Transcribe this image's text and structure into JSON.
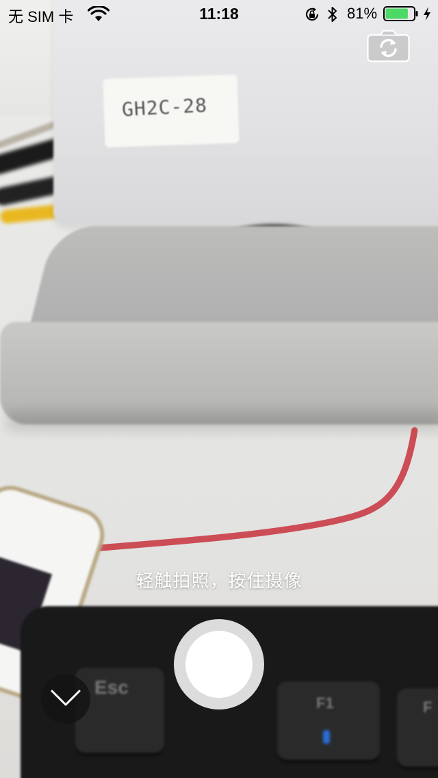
{
  "status_bar": {
    "carrier": "无 SIM 卡",
    "time": "11:18",
    "battery_percent": "81%",
    "battery_level": 0.81,
    "icons": [
      "wifi-icon",
      "orientation-lock-icon",
      "bluetooth-icon",
      "battery-icon",
      "charging-bolt-icon"
    ]
  },
  "viewfinder": {
    "label_text": "GH2C-28",
    "keys": [
      "Esc",
      "F1",
      "F"
    ]
  },
  "camera": {
    "hint": "轻触拍照，按住摄像",
    "switch_camera_icon": "switch-camera-icon",
    "collapse_icon": "chevron-down-icon"
  },
  "colors": {
    "battery_fill": "#4cd964",
    "hint_text": "#ffffff",
    "shutter_ring": "#dcdcdc",
    "shutter_core": "#ffffff",
    "cable_red": "#c8323c"
  }
}
